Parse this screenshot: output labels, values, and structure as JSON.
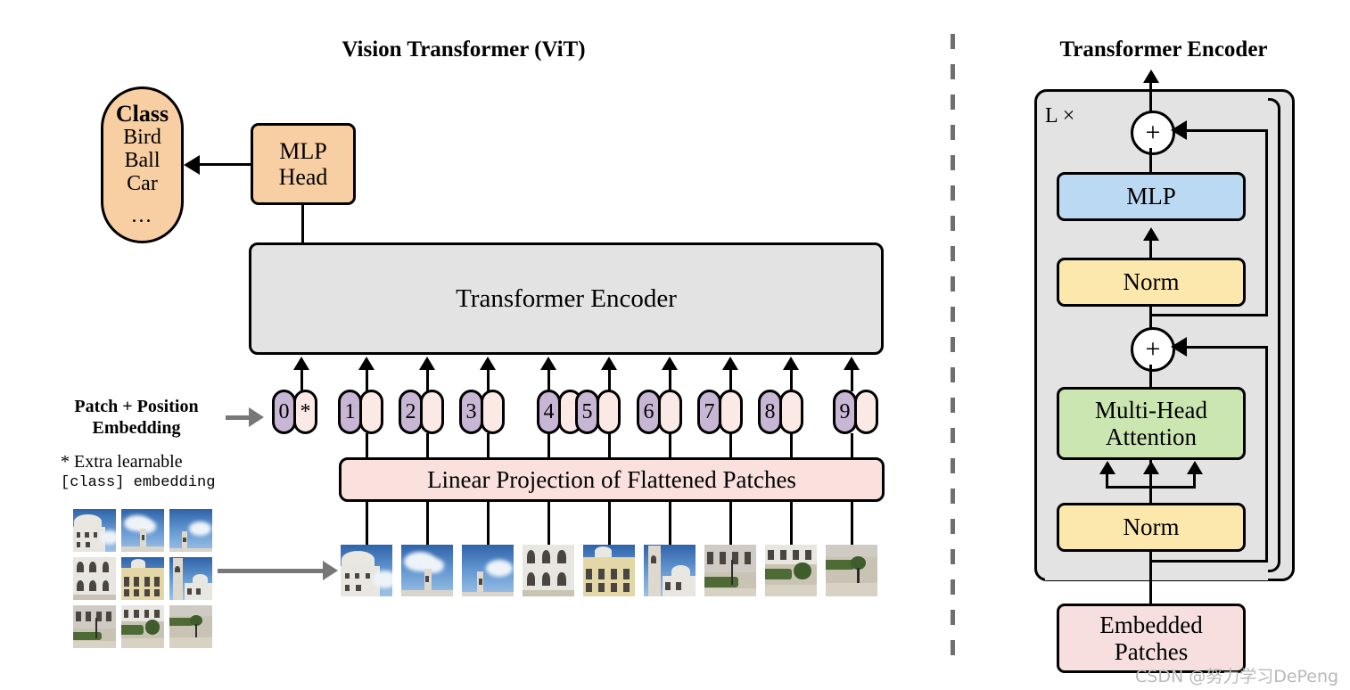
{
  "figure": {
    "left_title": "Vision Transformer (ViT)",
    "right_title": "Transformer Encoder"
  },
  "left_panel": {
    "class_box": {
      "heading": "Class",
      "labels": [
        "Bird",
        "Ball",
        "Car"
      ],
      "ellipsis": "...",
      "color": "#F8CFA2"
    },
    "mlp_head": {
      "line1": "MLP",
      "line2": "Head",
      "color": "#F8CFA2"
    },
    "encoder_box": {
      "label": "Transformer Encoder",
      "color": "#E3E3E3"
    },
    "embedding_label": {
      "line1": "Patch + Position",
      "line2": "Embedding"
    },
    "footnote": {
      "line1": "* Extra learnable",
      "line2": "[class] embedding"
    },
    "tokens": [
      {
        "position": "0",
        "patch": "*",
        "is_class": true
      },
      {
        "position": "1",
        "patch": ""
      },
      {
        "position": "2",
        "patch": ""
      },
      {
        "position": "3",
        "patch": ""
      },
      {
        "position": "4",
        "patch": ""
      },
      {
        "position": "5",
        "patch": ""
      },
      {
        "position": "6",
        "patch": ""
      },
      {
        "position": "7",
        "patch": ""
      },
      {
        "position": "8",
        "patch": ""
      },
      {
        "position": "9",
        "patch": ""
      }
    ],
    "token_colors": {
      "position": "#C8B7D4",
      "patch": "#FAE9E4"
    },
    "linear_projection": {
      "label": "Linear Projection of Flattened Patches",
      "color": "#FAE1DD"
    },
    "source_image_grid": {
      "rows": 3,
      "cols": 3
    },
    "flattened_patch_count": 9
  },
  "right_panel": {
    "repeat_label": "L ×",
    "blocks": [
      {
        "name": "mlp",
        "label": "MLP",
        "color": "#BBD9F2"
      },
      {
        "name": "norm_top",
        "label": "Norm",
        "color": "#FCE8AC"
      },
      {
        "name": "multi_head_attention",
        "line1": "Multi-Head",
        "line2": "Attention",
        "color": "#CBE6B0"
      },
      {
        "name": "norm_bottom",
        "label": "Norm",
        "color": "#FCE8AC"
      },
      {
        "name": "embedded_patches",
        "line1": "Embedded",
        "line2": "Patches",
        "color": "#F6DFDE"
      }
    ],
    "residual_add_symbol": "+",
    "container_color": "#E3E3E3"
  },
  "watermark": {
    "text": "CSDN @努力学习DePeng",
    "color": "#b9b9b9"
  }
}
